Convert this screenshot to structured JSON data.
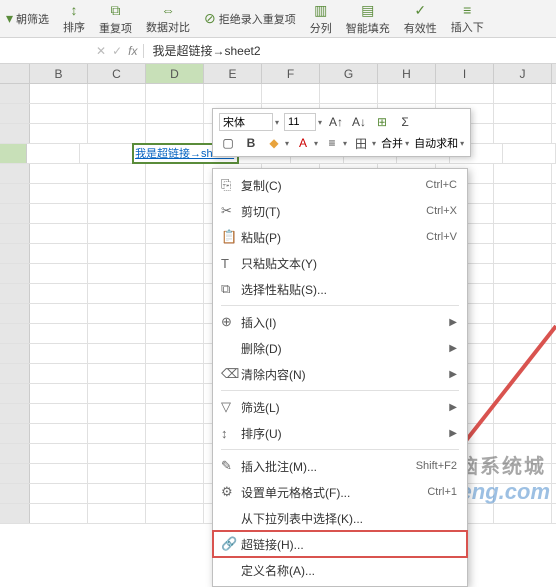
{
  "ribbon": {
    "left_partial": "朝筛选",
    "sort": "排序",
    "dedup": "重复项",
    "compare": "数据对比",
    "reject_dup": "拒绝录入重复项",
    "split": "分列",
    "smart_fill": "智能填充",
    "validate": "有效性",
    "insert_down": "插入下"
  },
  "formula": {
    "fx_label": "fx",
    "value": "我是超链接→sheet2"
  },
  "columns": [
    "B",
    "C",
    "D",
    "E",
    "F",
    "G",
    "H",
    "I",
    "J"
  ],
  "active_col_index": 2,
  "active_row_index": 3,
  "cell_value": "我是超链接→sheet2",
  "mini": {
    "font": "宋体",
    "size": "11",
    "merge": "合并",
    "autosum": "自动求和"
  },
  "menu": [
    {
      "icon": "copy",
      "label": "复制(C)",
      "short": "Ctrl+C"
    },
    {
      "icon": "cut",
      "label": "剪切(T)",
      "short": "Ctrl+X"
    },
    {
      "icon": "paste",
      "label": "粘贴(P)",
      "short": "Ctrl+V"
    },
    {
      "icon": "paste-text",
      "label": "只粘贴文本(Y)"
    },
    {
      "icon": "paste-special",
      "label": "选择性粘贴(S)..."
    },
    {
      "sep": true
    },
    {
      "icon": "insert",
      "label": "插入(I)",
      "arrow": true
    },
    {
      "icon": "",
      "label": "删除(D)",
      "arrow": true
    },
    {
      "icon": "clear",
      "label": "清除内容(N)",
      "arrow": true
    },
    {
      "sep": true
    },
    {
      "icon": "filter",
      "label": "筛选(L)",
      "arrow": true
    },
    {
      "icon": "sort",
      "label": "排序(U)",
      "arrow": true
    },
    {
      "sep": true
    },
    {
      "icon": "comment",
      "label": "插入批注(M)...",
      "short": "Shift+F2"
    },
    {
      "icon": "format",
      "label": "设置单元格格式(F)...",
      "short": "Ctrl+1"
    },
    {
      "icon": "",
      "label": "从下拉列表中选择(K)..."
    },
    {
      "icon": "link",
      "label": "超链接(H)...",
      "highlight": true
    },
    {
      "icon": "",
      "label": "定义名称(A)..."
    }
  ],
  "watermark1": "电脑系统城",
  "watermark2": "pcxitongcheng.com"
}
